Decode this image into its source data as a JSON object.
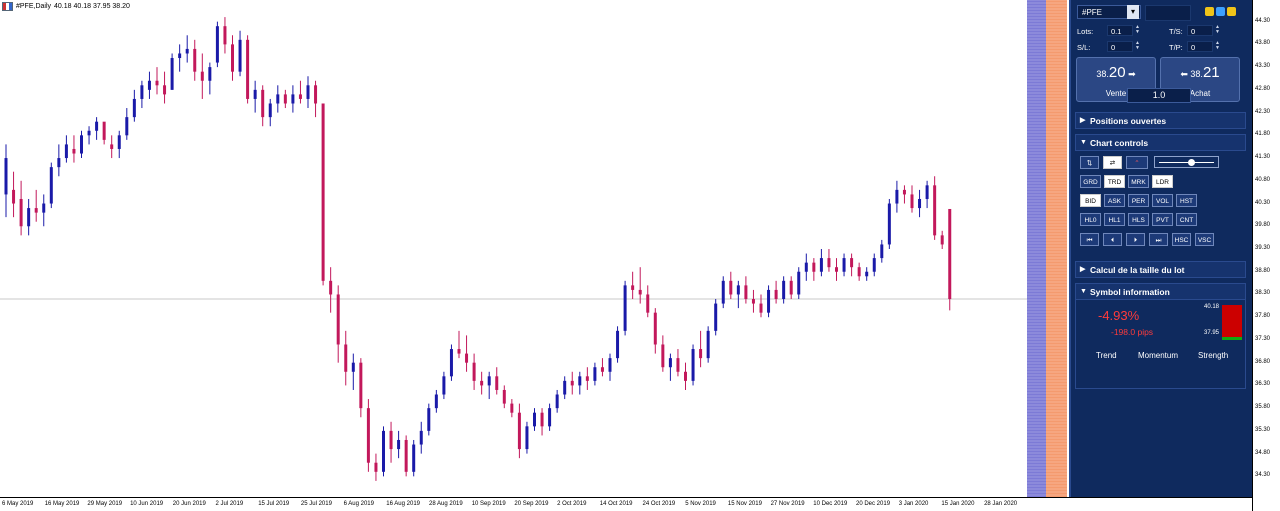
{
  "header": {
    "symbol_tf": "#PFE,Daily",
    "ohlc": "40.18 40.18 37.95 38.20"
  },
  "panel": {
    "symbol": "#PFE",
    "lots_label": "Lots:",
    "lots_value": "0.1",
    "sl_label": "S/L:",
    "sl_value": "0",
    "ts_label": "T/S:",
    "ts_value": "0",
    "tp_label": "T/P:",
    "tp_value": "0",
    "sell": {
      "price_small": "38.",
      "price_big": "20",
      "label": "Vente"
    },
    "buy": {
      "price_small": "38.",
      "price_big": "21",
      "label": "Achat"
    },
    "lot_size": "1.0",
    "sections": {
      "positions": "Positions ouvertes",
      "controls": "Chart controls",
      "lotcalc": "Calcul de la taille du lot",
      "syminfo": "Symbol information"
    },
    "buttons_row2": [
      "GRD",
      "TRD",
      "MRK",
      "LDR"
    ],
    "buttons_row3": [
      "BID",
      "ASK",
      "PER",
      "VOL",
      "HST"
    ],
    "buttons_row4": [
      "HL0",
      "HL1",
      "HLS",
      "PVT",
      "CNT"
    ],
    "buttons_row5_extra": [
      "HSC",
      "VSC"
    ],
    "info": {
      "pct": "-4.93%",
      "pips": "-198.0 pips",
      "high": "40.18",
      "low": "37.95",
      "trend": "Trend",
      "momentum": "Momentum",
      "strength": "Strength"
    }
  },
  "colors": {
    "bull": "#1a1aa8",
    "bear": "#c2185b",
    "panel": "#0f2a5e"
  },
  "y_axis": {
    "ticks": [
      "44.30",
      "43.80",
      "43.30",
      "42.80",
      "42.30",
      "41.80",
      "41.30",
      "40.80",
      "40.30",
      "39.80",
      "39.30",
      "38.80",
      "38.30",
      "37.80",
      "37.30",
      "36.80",
      "36.30",
      "35.80",
      "35.30",
      "34.80",
      "34.30"
    ]
  },
  "x_axis": {
    "ticks": [
      "6 May 2019",
      "16 May 2019",
      "29 May 2019",
      "10 Jun 2019",
      "20 Jun 2019",
      "2 Jul 2019",
      "15 Jul 2019",
      "25 Jul 2019",
      "6 Aug 2019",
      "16 Aug 2019",
      "28 Aug 2019",
      "10 Sep 2019",
      "20 Sep 2019",
      "2 Oct 2019",
      "14 Oct 2019",
      "24 Oct 2019",
      "5 Nov 2019",
      "15 Nov 2019",
      "27 Nov 2019",
      "10 Dec 2019",
      "20 Dec 2019",
      "3 Jan 2020",
      "15 Jan 2020",
      "28 Jan 2020"
    ]
  },
  "chart_data": {
    "type": "candlestick",
    "ylim": [
      34.0,
      44.6
    ],
    "last_price": 38.2,
    "candles": [
      [
        40.5,
        41.6,
        40.0,
        41.3
      ],
      [
        40.6,
        41.0,
        40.0,
        40.3
      ],
      [
        40.4,
        40.8,
        39.6,
        39.8
      ],
      [
        39.8,
        40.4,
        39.6,
        40.2
      ],
      [
        40.2,
        40.6,
        39.9,
        40.1
      ],
      [
        40.1,
        40.5,
        39.8,
        40.3
      ],
      [
        40.3,
        41.2,
        40.2,
        41.1
      ],
      [
        41.1,
        41.6,
        40.9,
        41.3
      ],
      [
        41.3,
        41.8,
        41.2,
        41.6
      ],
      [
        41.5,
        41.8,
        41.2,
        41.4
      ],
      [
        41.4,
        41.9,
        41.3,
        41.8
      ],
      [
        41.8,
        42.0,
        41.6,
        41.9
      ],
      [
        41.9,
        42.2,
        41.7,
        42.1
      ],
      [
        42.1,
        42.0,
        41.6,
        41.7
      ],
      [
        41.6,
        41.8,
        41.3,
        41.5
      ],
      [
        41.5,
        41.9,
        41.3,
        41.8
      ],
      [
        41.8,
        42.4,
        41.7,
        42.2
      ],
      [
        42.2,
        42.8,
        42.1,
        42.6
      ],
      [
        42.6,
        43.0,
        42.4,
        42.9
      ],
      [
        42.8,
        43.2,
        42.6,
        43.0
      ],
      [
        43.0,
        43.3,
        42.7,
        42.9
      ],
      [
        42.9,
        43.2,
        42.5,
        42.7
      ],
      [
        42.8,
        43.6,
        42.8,
        43.5
      ],
      [
        43.5,
        43.8,
        43.2,
        43.6
      ],
      [
        43.6,
        44.0,
        43.4,
        43.7
      ],
      [
        43.7,
        43.9,
        43.0,
        43.2
      ],
      [
        43.2,
        43.6,
        42.6,
        43.0
      ],
      [
        43.0,
        43.4,
        42.7,
        43.3
      ],
      [
        43.4,
        44.3,
        43.3,
        44.2
      ],
      [
        44.2,
        44.4,
        43.6,
        43.8
      ],
      [
        43.8,
        44.0,
        43.0,
        43.2
      ],
      [
        43.2,
        44.1,
        43.1,
        43.9
      ],
      [
        43.9,
        44.0,
        42.5,
        42.6
      ],
      [
        42.6,
        43.0,
        42.3,
        42.8
      ],
      [
        42.8,
        42.9,
        42.0,
        42.2
      ],
      [
        42.2,
        42.6,
        42.0,
        42.5
      ],
      [
        42.5,
        42.9,
        42.3,
        42.7
      ],
      [
        42.7,
        42.8,
        42.4,
        42.5
      ],
      [
        42.5,
        42.9,
        42.3,
        42.7
      ],
      [
        42.7,
        43.0,
        42.5,
        42.6
      ],
      [
        42.6,
        43.1,
        42.4,
        42.9
      ],
      [
        42.9,
        43.0,
        42.2,
        42.5
      ],
      [
        42.5,
        42.0,
        38.5,
        38.6
      ],
      [
        38.6,
        38.9,
        37.9,
        38.3
      ],
      [
        38.3,
        38.5,
        36.8,
        37.2
      ],
      [
        37.2,
        37.5,
        36.3,
        36.6
      ],
      [
        36.6,
        37.0,
        36.2,
        36.8
      ],
      [
        36.8,
        36.9,
        35.6,
        35.8
      ],
      [
        35.8,
        36.0,
        34.4,
        34.6
      ],
      [
        34.6,
        34.8,
        34.2,
        34.4
      ],
      [
        34.4,
        35.4,
        34.3,
        35.3
      ],
      [
        35.3,
        35.5,
        34.6,
        34.9
      ],
      [
        34.9,
        35.3,
        34.7,
        35.1
      ],
      [
        35.1,
        35.2,
        34.3,
        34.4
      ],
      [
        34.4,
        35.1,
        34.3,
        35.0
      ],
      [
        35.0,
        35.5,
        34.8,
        35.3
      ],
      [
        35.3,
        35.9,
        35.2,
        35.8
      ],
      [
        35.8,
        36.2,
        35.7,
        36.1
      ],
      [
        36.1,
        36.6,
        36.0,
        36.5
      ],
      [
        36.5,
        37.2,
        36.4,
        37.1
      ],
      [
        37.1,
        37.5,
        36.9,
        37.0
      ],
      [
        37.0,
        37.4,
        36.6,
        36.8
      ],
      [
        36.8,
        37.0,
        36.2,
        36.4
      ],
      [
        36.4,
        36.6,
        36.1,
        36.3
      ],
      [
        36.3,
        36.6,
        36.0,
        36.5
      ],
      [
        36.5,
        36.7,
        36.1,
        36.2
      ],
      [
        36.2,
        36.3,
        35.8,
        35.9
      ],
      [
        35.9,
        36.0,
        35.6,
        35.7
      ],
      [
        35.7,
        35.9,
        34.7,
        34.9
      ],
      [
        34.9,
        35.5,
        34.8,
        35.4
      ],
      [
        35.4,
        35.8,
        35.3,
        35.7
      ],
      [
        35.7,
        35.8,
        35.2,
        35.4
      ],
      [
        35.4,
        35.9,
        35.3,
        35.8
      ],
      [
        35.8,
        36.2,
        35.7,
        36.1
      ],
      [
        36.1,
        36.5,
        36.0,
        36.4
      ],
      [
        36.4,
        36.6,
        36.1,
        36.3
      ],
      [
        36.3,
        36.6,
        36.1,
        36.5
      ],
      [
        36.5,
        36.7,
        36.2,
        36.4
      ],
      [
        36.4,
        36.8,
        36.3,
        36.7
      ],
      [
        36.7,
        36.9,
        36.5,
        36.6
      ],
      [
        36.6,
        37.0,
        36.4,
        36.9
      ],
      [
        36.9,
        37.6,
        36.8,
        37.5
      ],
      [
        37.5,
        38.6,
        37.4,
        38.5
      ],
      [
        38.5,
        38.8,
        38.2,
        38.4
      ],
      [
        38.4,
        38.9,
        38.1,
        38.3
      ],
      [
        38.3,
        38.5,
        37.8,
        37.9
      ],
      [
        37.9,
        38.0,
        37.0,
        37.2
      ],
      [
        37.2,
        37.4,
        36.6,
        36.7
      ],
      [
        36.7,
        37.0,
        36.4,
        36.9
      ],
      [
        36.9,
        37.1,
        36.5,
        36.6
      ],
      [
        36.6,
        36.8,
        36.2,
        36.4
      ],
      [
        36.4,
        37.2,
        36.3,
        37.1
      ],
      [
        37.1,
        37.5,
        36.7,
        36.9
      ],
      [
        36.9,
        37.6,
        36.8,
        37.5
      ],
      [
        37.5,
        38.2,
        37.4,
        38.1
      ],
      [
        38.1,
        38.7,
        38.0,
        38.6
      ],
      [
        38.6,
        38.8,
        38.2,
        38.3
      ],
      [
        38.3,
        38.6,
        38.0,
        38.5
      ],
      [
        38.5,
        38.7,
        38.1,
        38.2
      ],
      [
        38.2,
        38.4,
        37.9,
        38.1
      ],
      [
        38.1,
        38.3,
        37.8,
        37.9
      ],
      [
        37.9,
        38.5,
        37.8,
        38.4
      ],
      [
        38.4,
        38.6,
        38.1,
        38.2
      ],
      [
        38.2,
        38.7,
        38.1,
        38.6
      ],
      [
        38.6,
        38.7,
        38.2,
        38.3
      ],
      [
        38.3,
        38.9,
        38.2,
        38.8
      ],
      [
        38.8,
        39.2,
        38.6,
        39.0
      ],
      [
        39.0,
        39.1,
        38.6,
        38.8
      ],
      [
        38.8,
        39.3,
        38.7,
        39.1
      ],
      [
        39.1,
        39.3,
        38.8,
        38.9
      ],
      [
        38.9,
        39.1,
        38.6,
        38.8
      ],
      [
        38.8,
        39.2,
        38.7,
        39.1
      ],
      [
        39.1,
        39.2,
        38.7,
        38.9
      ],
      [
        38.9,
        39.0,
        38.6,
        38.7
      ],
      [
        38.7,
        38.9,
        38.6,
        38.8
      ],
      [
        38.8,
        39.2,
        38.7,
        39.1
      ],
      [
        39.1,
        39.5,
        39.0,
        39.4
      ],
      [
        39.4,
        40.4,
        39.3,
        40.3
      ],
      [
        40.3,
        40.8,
        40.1,
        40.6
      ],
      [
        40.6,
        40.7,
        40.3,
        40.5
      ],
      [
        40.5,
        40.7,
        40.1,
        40.2
      ],
      [
        40.2,
        40.6,
        40.0,
        40.4
      ],
      [
        40.4,
        40.8,
        40.2,
        40.7
      ],
      [
        40.7,
        40.9,
        39.5,
        39.6
      ],
      [
        39.6,
        39.7,
        39.3,
        39.4
      ],
      [
        40.18,
        40.18,
        37.95,
        38.2
      ]
    ]
  }
}
